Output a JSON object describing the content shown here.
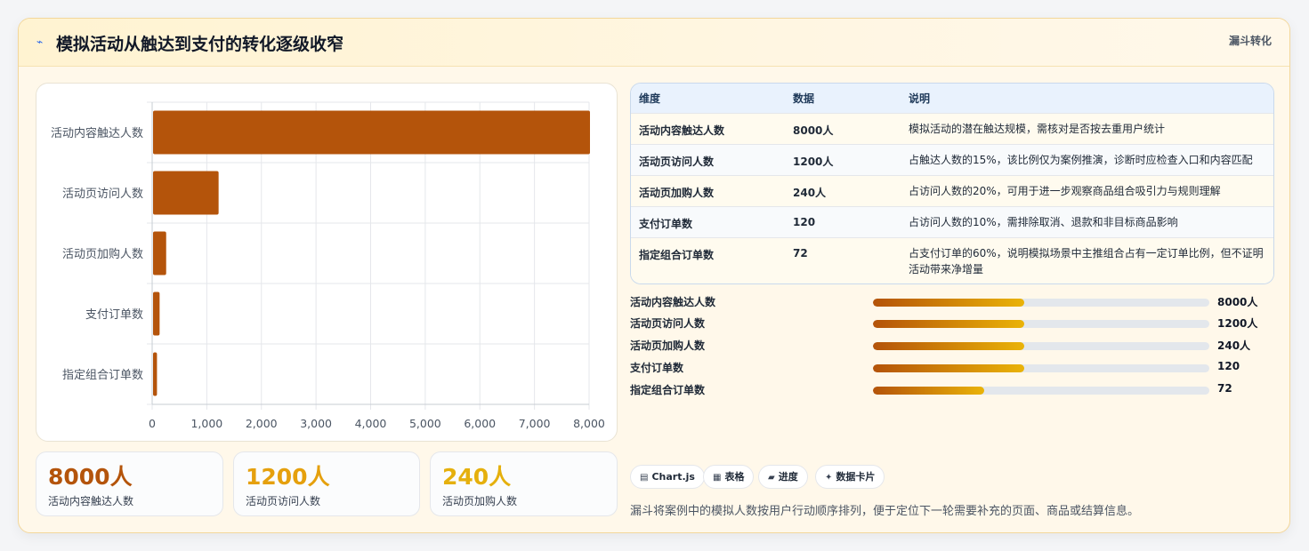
{
  "header": {
    "icon": "trend-icon",
    "title": "模拟活动从触达到支付的转化逐级收窄",
    "tag": "漏斗转化"
  },
  "chart_data": {
    "type": "bar",
    "orientation": "horizontal",
    "categories": [
      "活动内容触达人数",
      "活动页访问人数",
      "活动页加购人数",
      "支付订单数",
      "指定组合订单数"
    ],
    "values": [
      8000,
      1200,
      240,
      120,
      72
    ],
    "xlim": [
      0,
      8000
    ],
    "xticks": [
      0,
      1000,
      2000,
      3000,
      4000,
      5000,
      6000,
      7000,
      8000
    ],
    "xtick_labels": [
      "0",
      "1,000",
      "2,000",
      "3,000",
      "4,000",
      "5,000",
      "6,000",
      "7,000",
      "8,000"
    ],
    "grid": true,
    "bar_color": "#b4540b"
  },
  "kpis": [
    {
      "value": "8000人",
      "label": "活动内容触达人数",
      "color": "#b4540b"
    },
    {
      "value": "1200人",
      "label": "活动页访问人数",
      "color": "#e5a00d"
    },
    {
      "value": "240人",
      "label": "活动页加购人数",
      "color": "#e5b00d"
    }
  ],
  "table": {
    "headers": [
      "维度",
      "数据",
      "说明"
    ],
    "rows": [
      {
        "dim": "活动内容触达人数",
        "num": "8000人",
        "desc": "模拟活动的潜在触达规模，需核对是否按去重用户统计"
      },
      {
        "dim": "活动页访问人数",
        "num": "1200人",
        "desc": "占触达人数的15%，该比例仅为案例推演，诊断时应检查入口和内容匹配"
      },
      {
        "dim": "活动页加购人数",
        "num": "240人",
        "desc": "占访问人数的20%，可用于进一步观察商品组合吸引力与规则理解"
      },
      {
        "dim": "支付订单数",
        "num": "120",
        "desc": "占访问人数的10%，需排除取消、退款和非目标商品影响"
      },
      {
        "dim": "指定组合订单数",
        "num": "72",
        "desc": "占支付订单的60%，说明模拟场景中主推组合占有一定订单比例，但不证明活动带来净增量"
      }
    ]
  },
  "progress": [
    {
      "label": "活动内容触达人数",
      "value": "8000人",
      "fill": 0.45
    },
    {
      "label": "活动页访问人数",
      "value": "1200人",
      "fill": 0.45
    },
    {
      "label": "活动页加购人数",
      "value": "240人",
      "fill": 0.45
    },
    {
      "label": "支付订单数",
      "value": "120",
      "fill": 0.45
    },
    {
      "label": "指定组合订单数",
      "value": "72",
      "fill": 0.33
    }
  ],
  "chips": [
    {
      "icon": "chart-icon",
      "glyph": "▤",
      "label": "Chart.js"
    },
    {
      "icon": "table-icon",
      "glyph": "▦",
      "label": "表格"
    },
    {
      "icon": "progress-icon",
      "glyph": "▰",
      "label": "进度"
    },
    {
      "icon": "sparkle-icon",
      "glyph": "✦",
      "label": "数据卡片"
    }
  ],
  "footnote": "漏斗将案例中的模拟人数按用户行动顺序排列，便于定位下一轮需要补充的页面、商品或结算信息。"
}
